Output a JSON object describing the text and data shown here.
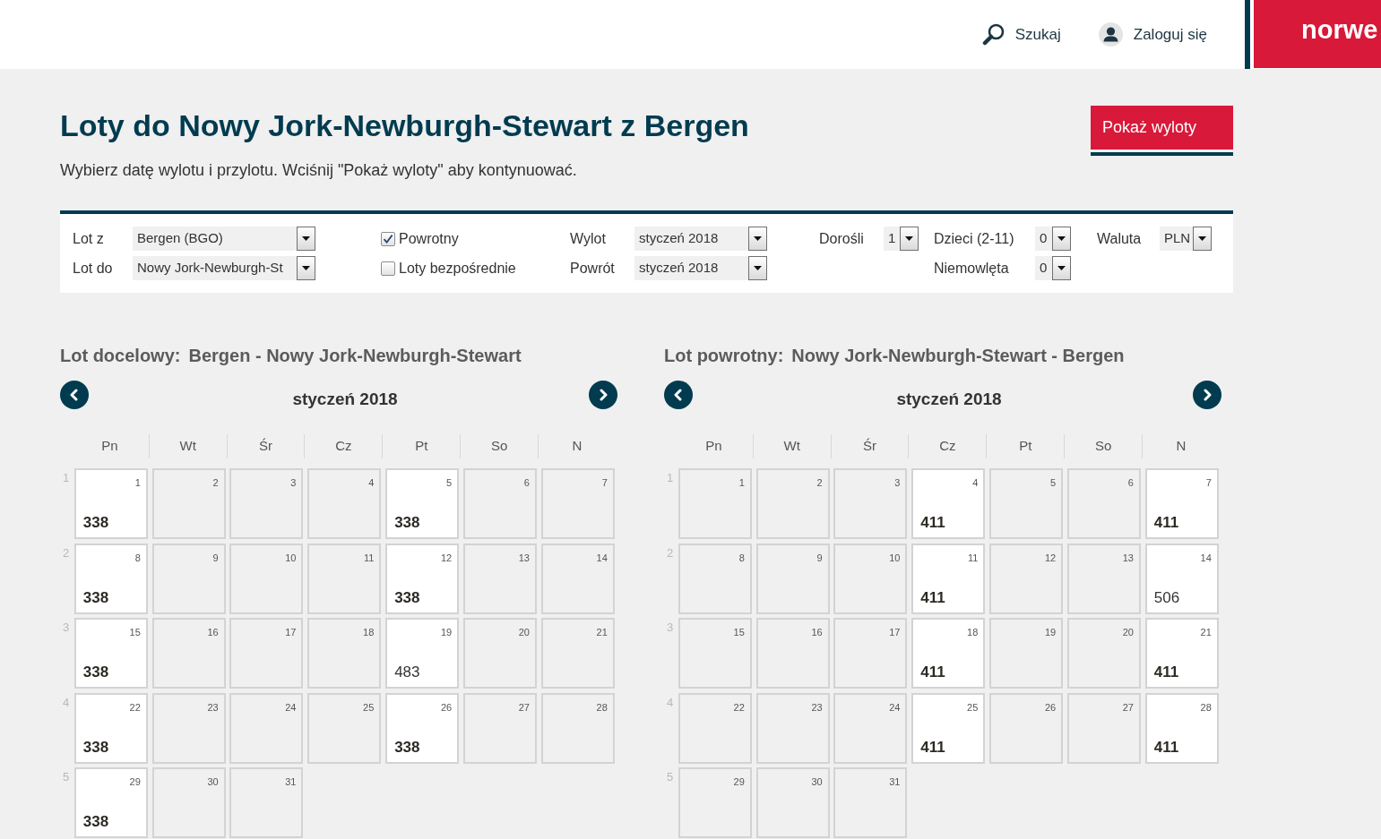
{
  "header": {
    "nav_items": [
      {
        "kind": "search",
        "label": "Szukaj"
      },
      {
        "kind": "user",
        "label": "Zaloguj się"
      }
    ],
    "logo": "norwe"
  },
  "page": {
    "title": "Loty do Nowy Jork-Newburgh-Stewart z Bergen",
    "subtitle": "Wybierz datę wylotu i przylotu. Wciśnij \"Pokaż wyloty\" aby kontynuować.",
    "action_button": "Pokaż wyloty"
  },
  "search_form": {
    "columns": [
      {
        "kind": "select",
        "fields": [
          {
            "label": "Lot z",
            "value": "Bergen (BGO)"
          },
          {
            "label": "Lot do",
            "value": "Nowy Jork-Newburgh-St"
          }
        ]
      },
      {
        "kind": "checkbox",
        "fields": [
          {
            "label": "Powrotny",
            "checked": true
          },
          {
            "label": "Loty bezpośrednie",
            "checked": false
          }
        ]
      },
      {
        "kind": "select",
        "fields": [
          {
            "label": "Wylot",
            "value": "styczeń 2018"
          },
          {
            "label": "Powrót",
            "value": "styczeń 2018"
          }
        ]
      },
      {
        "kind": "select",
        "fields": [
          {
            "label": "Dorośli",
            "value": "1"
          }
        ]
      },
      {
        "kind": "select",
        "fields": [
          {
            "label": "Dzieci (2-11)",
            "value": "0"
          },
          {
            "label": "Niemowlęta",
            "value": "0"
          }
        ]
      },
      {
        "kind": "select",
        "fields": [
          {
            "label": "Waluta",
            "value": "PLN"
          }
        ]
      }
    ]
  },
  "calendars": [
    {
      "label": "Lot docelowy:",
      "route": "Bergen - Nowy Jork-Newburgh-Stewart",
      "month": "styczeń 2018",
      "weekdays": [
        "Pn",
        "Wt",
        "Śr",
        "Cz",
        "Pt",
        "So",
        "N"
      ],
      "weeks": [
        {
          "number": "1",
          "days": [
            {
              "day": "1",
              "price": {
                "amount": "338",
                "cheapest": true
              }
            },
            {
              "day": "2"
            },
            {
              "day": "3"
            },
            {
              "day": "4"
            },
            {
              "day": "5",
              "price": {
                "amount": "338",
                "cheapest": true
              }
            },
            {
              "day": "6"
            },
            {
              "day": "7"
            }
          ]
        },
        {
          "number": "2",
          "days": [
            {
              "day": "8",
              "price": {
                "amount": "338",
                "cheapest": true
              }
            },
            {
              "day": "9"
            },
            {
              "day": "10"
            },
            {
              "day": "11"
            },
            {
              "day": "12",
              "price": {
                "amount": "338",
                "cheapest": true
              }
            },
            {
              "day": "13"
            },
            {
              "day": "14"
            }
          ]
        },
        {
          "number": "3",
          "days": [
            {
              "day": "15",
              "price": {
                "amount": "338",
                "cheapest": true
              }
            },
            {
              "day": "16"
            },
            {
              "day": "17"
            },
            {
              "day": "18"
            },
            {
              "day": "19",
              "price": {
                "amount": "483",
                "cheapest": false
              }
            },
            {
              "day": "20"
            },
            {
              "day": "21"
            }
          ]
        },
        {
          "number": "4",
          "days": [
            {
              "day": "22",
              "price": {
                "amount": "338",
                "cheapest": true
              }
            },
            {
              "day": "23"
            },
            {
              "day": "24"
            },
            {
              "day": "25"
            },
            {
              "day": "26",
              "price": {
                "amount": "338",
                "cheapest": true
              }
            },
            {
              "day": "27"
            },
            {
              "day": "28"
            }
          ]
        },
        {
          "number": "5",
          "days": [
            {
              "day": "29",
              "price": {
                "amount": "338",
                "cheapest": true
              }
            },
            {
              "day": "30"
            },
            {
              "day": "31"
            }
          ]
        }
      ]
    },
    {
      "label": "Lot powrotny:",
      "route": "Nowy Jork-Newburgh-Stewart - Bergen",
      "month": "styczeń 2018",
      "weekdays": [
        "Pn",
        "Wt",
        "Śr",
        "Cz",
        "Pt",
        "So",
        "N"
      ],
      "weeks": [
        {
          "number": "1",
          "days": [
            {
              "day": "1"
            },
            {
              "day": "2"
            },
            {
              "day": "3"
            },
            {
              "day": "4",
              "price": {
                "amount": "411",
                "cheapest": true
              }
            },
            {
              "day": "5"
            },
            {
              "day": "6"
            },
            {
              "day": "7",
              "price": {
                "amount": "411",
                "cheapest": true
              }
            }
          ]
        },
        {
          "number": "2",
          "days": [
            {
              "day": "8"
            },
            {
              "day": "9"
            },
            {
              "day": "10"
            },
            {
              "day": "11",
              "price": {
                "amount": "411",
                "cheapest": true
              }
            },
            {
              "day": "12"
            },
            {
              "day": "13"
            },
            {
              "day": "14",
              "price": {
                "amount": "506",
                "cheapest": false
              }
            }
          ]
        },
        {
          "number": "3",
          "days": [
            {
              "day": "15"
            },
            {
              "day": "16"
            },
            {
              "day": "17"
            },
            {
              "day": "18",
              "price": {
                "amount": "411",
                "cheapest": true
              }
            },
            {
              "day": "19"
            },
            {
              "day": "20"
            },
            {
              "day": "21",
              "price": {
                "amount": "411",
                "cheapest": true
              }
            }
          ]
        },
        {
          "number": "4",
          "days": [
            {
              "day": "22"
            },
            {
              "day": "23"
            },
            {
              "day": "24"
            },
            {
              "day": "25",
              "price": {
                "amount": "411",
                "cheapest": true
              }
            },
            {
              "day": "26"
            },
            {
              "day": "27"
            },
            {
              "day": "28",
              "price": {
                "amount": "411",
                "cheapest": true
              }
            }
          ]
        },
        {
          "number": "5",
          "days": [
            {
              "day": "29"
            },
            {
              "day": "30"
            },
            {
              "day": "31"
            }
          ]
        }
      ]
    }
  ]
}
